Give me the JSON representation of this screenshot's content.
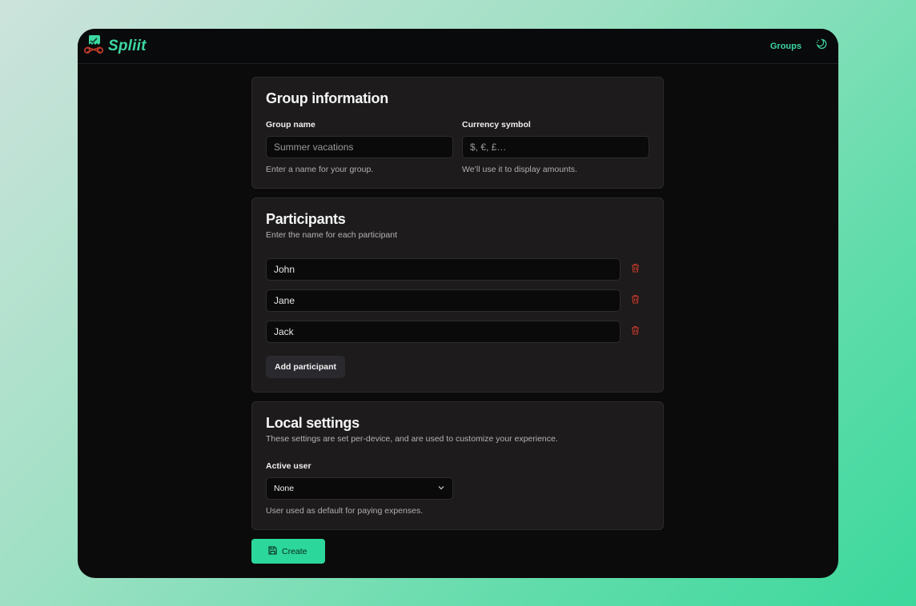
{
  "app": {
    "name": "Spliit"
  },
  "nav": {
    "groups": "Groups"
  },
  "group_info": {
    "title": "Group information",
    "name_label": "Group name",
    "name_placeholder": "Summer vacations",
    "name_help": "Enter a name for your group.",
    "currency_label": "Currency symbol",
    "currency_placeholder": "$, €, £…",
    "currency_help": "We’ll use it to display amounts."
  },
  "participants": {
    "title": "Participants",
    "description": "Enter the name for each participant",
    "items": [
      {
        "name": "John"
      },
      {
        "name": "Jane"
      },
      {
        "name": "Jack"
      }
    ],
    "add_label": "Add participant"
  },
  "local_settings": {
    "title": "Local settings",
    "description": "These settings are set per-device, and are used to customize your experience.",
    "active_user_label": "Active user",
    "active_user_value": "None",
    "active_user_help": "User used as default for paying expenses."
  },
  "actions": {
    "create_label": "Create"
  },
  "colors": {
    "accent": "#3dd6a0",
    "primary_button": "#2bd79a",
    "danger": "#c0392b",
    "background": "#0c0b0b",
    "card": "#1d1b1b"
  },
  "icons": {
    "logo": "scissors-receipt-logo",
    "theme": "moon-sun-icon",
    "delete": "trash-icon",
    "dropdown": "chevron-down-icon",
    "save": "save-icon"
  }
}
